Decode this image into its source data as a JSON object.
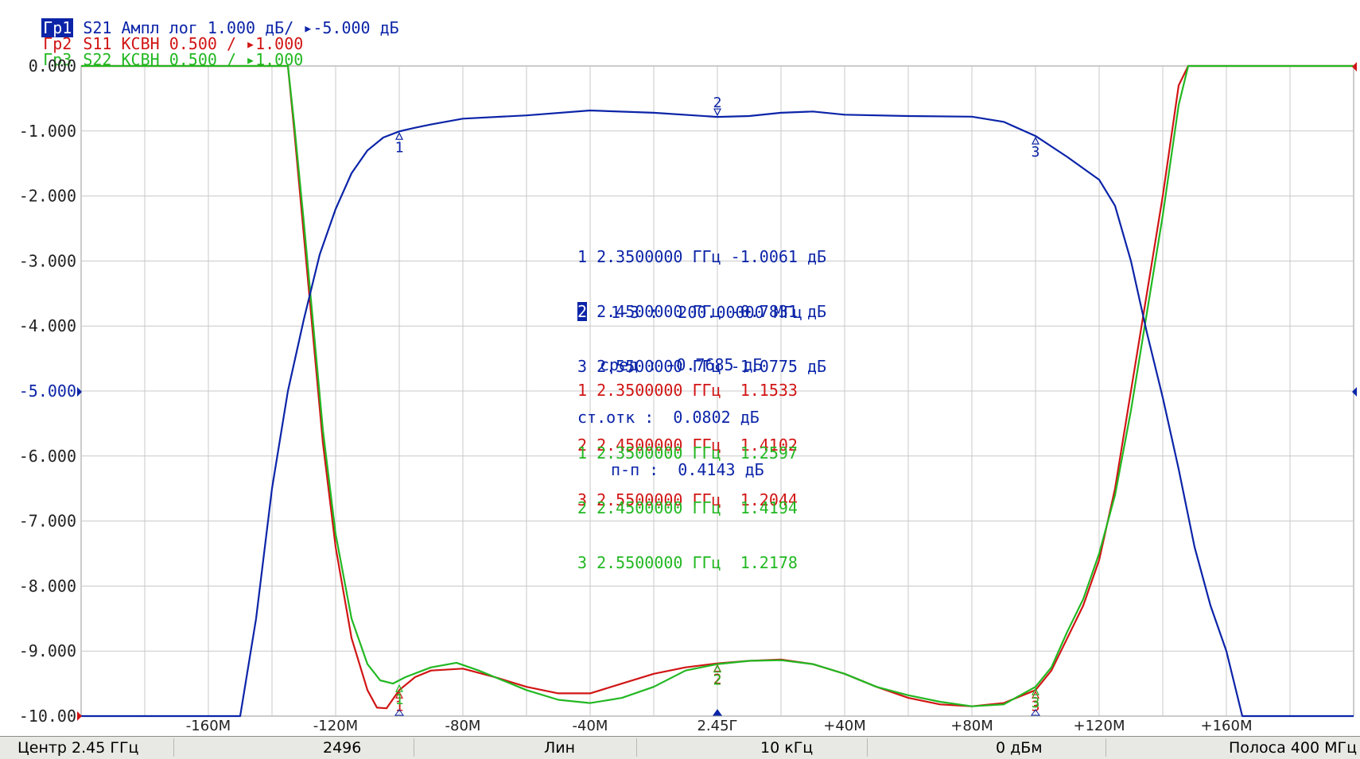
{
  "traces_header": [
    {
      "id": "tr1",
      "tag": "Гр1",
      "text": " S21 Ампл лог 1.000 дБ/ ▸-5.000 дБ",
      "color": "#0b24a8"
    },
    {
      "id": "tr2",
      "tag": "Гр2",
      "text": " S11 КСВН 0.500 / ▸1.000",
      "color": "#d11515"
    },
    {
      "id": "tr3",
      "tag": "Гр3",
      "text": " S22 КСВН 0.500 / ▸1.000",
      "color": "#22b822"
    }
  ],
  "colors": {
    "s21": "#0b24a8",
    "s11": "#d11515",
    "s22": "#22b822",
    "grid": "#c8c8c8",
    "axis_text": "#222222"
  },
  "chart_data": {
    "type": "line",
    "x_unit": "MHz offset from center 2.45 GHz",
    "xlim": [
      -200,
      200
    ],
    "ylim": [
      -10,
      0
    ],
    "grid": true,
    "y_ticks": [
      "0.000",
      "-1.000",
      "-2.000",
      "-3.000",
      "-4.000",
      "-5.000",
      "-6.000",
      "-7.000",
      "-8.000",
      "-9.000",
      "-10.00"
    ],
    "x_ticks": [
      {
        "x": -160,
        "label": "-160M"
      },
      {
        "x": -120,
        "label": "-120M"
      },
      {
        "x": -80,
        "label": "-80M"
      },
      {
        "x": -40,
        "label": "-40M"
      },
      {
        "x": 0,
        "label": "2.45Г"
      },
      {
        "x": 40,
        "label": "+40M"
      },
      {
        "x": 80,
        "label": "+80M"
      },
      {
        "x": 120,
        "label": "+120M"
      },
      {
        "x": 160,
        "label": "+160M"
      }
    ],
    "series": [
      {
        "id": "s21",
        "name": "S21",
        "points": [
          [
            -200,
            -10
          ],
          [
            -150,
            -10
          ],
          [
            -145,
            -8.5
          ],
          [
            -140,
            -6.5
          ],
          [
            -135,
            -5
          ],
          [
            -130,
            -3.9
          ],
          [
            -125,
            -2.9
          ],
          [
            -120,
            -2.2
          ],
          [
            -115,
            -1.65
          ],
          [
            -110,
            -1.3
          ],
          [
            -105,
            -1.1
          ],
          [
            -100,
            -1.0061
          ],
          [
            -95,
            -0.95
          ],
          [
            -90,
            -0.9
          ],
          [
            -80,
            -0.81
          ],
          [
            -60,
            -0.76
          ],
          [
            -40,
            -0.685
          ],
          [
            -20,
            -0.72
          ],
          [
            0,
            -0.7831
          ],
          [
            10,
            -0.77
          ],
          [
            20,
            -0.72
          ],
          [
            30,
            -0.7
          ],
          [
            40,
            -0.75
          ],
          [
            60,
            -0.77
          ],
          [
            80,
            -0.78
          ],
          [
            90,
            -0.86
          ],
          [
            100,
            -1.0775
          ],
          [
            110,
            -1.4
          ],
          [
            120,
            -1.75
          ],
          [
            125,
            -2.15
          ],
          [
            130,
            -3.0
          ],
          [
            135,
            -4.1
          ],
          [
            140,
            -5.1
          ],
          [
            145,
            -6.2
          ],
          [
            150,
            -7.4
          ],
          [
            155,
            -8.3
          ],
          [
            160,
            -9.0
          ],
          [
            165,
            -10
          ],
          [
            200,
            -10
          ]
        ],
        "markers": [
          {
            "n": "1",
            "x": -100,
            "y": -1.0061
          },
          {
            "n": "2",
            "x": 0,
            "y": -0.7831
          },
          {
            "n": "3",
            "x": 100,
            "y": -1.0775
          }
        ]
      },
      {
        "id": "s11",
        "name": "S11",
        "points": [
          [
            -200,
            0
          ],
          [
            -135,
            0
          ],
          [
            -133,
            -1.0
          ],
          [
            -130,
            -2.6
          ],
          [
            -127,
            -4.2
          ],
          [
            -124,
            -5.8
          ],
          [
            -120,
            -7.4
          ],
          [
            -115,
            -8.8
          ],
          [
            -110,
            -9.6
          ],
          [
            -107,
            -9.87
          ],
          [
            -104,
            -9.88
          ],
          [
            -100,
            -9.6
          ],
          [
            -95,
            -9.4
          ],
          [
            -90,
            -9.3
          ],
          [
            -80,
            -9.27
          ],
          [
            -70,
            -9.4
          ],
          [
            -60,
            -9.55
          ],
          [
            -50,
            -9.65
          ],
          [
            -40,
            -9.65
          ],
          [
            -30,
            -9.5
          ],
          [
            -20,
            -9.35
          ],
          [
            -10,
            -9.25
          ],
          [
            0,
            -9.19
          ],
          [
            10,
            -9.15
          ],
          [
            20,
            -9.13
          ],
          [
            30,
            -9.2
          ],
          [
            40,
            -9.35
          ],
          [
            50,
            -9.55
          ],
          [
            60,
            -9.72
          ],
          [
            70,
            -9.82
          ],
          [
            80,
            -9.85
          ],
          [
            90,
            -9.8
          ],
          [
            100,
            -9.6
          ],
          [
            105,
            -9.3
          ],
          [
            110,
            -8.8
          ],
          [
            115,
            -8.3
          ],
          [
            120,
            -7.6
          ],
          [
            125,
            -6.5
          ],
          [
            130,
            -5.0
          ],
          [
            135,
            -3.5
          ],
          [
            140,
            -2.0
          ],
          [
            145,
            -0.3
          ],
          [
            148,
            0
          ],
          [
            200,
            0
          ]
        ],
        "markers": [
          {
            "n": "1",
            "x": -100,
            "y": -9.6
          },
          {
            "n": "2",
            "x": 0,
            "y": -9.19
          },
          {
            "n": "3",
            "x": 100,
            "y": -9.6
          }
        ]
      },
      {
        "id": "s22",
        "name": "S22",
        "points": [
          [
            -200,
            0
          ],
          [
            -135,
            0
          ],
          [
            -133,
            -0.9
          ],
          [
            -130,
            -2.4
          ],
          [
            -127,
            -4.0
          ],
          [
            -124,
            -5.6
          ],
          [
            -120,
            -7.2
          ],
          [
            -115,
            -8.5
          ],
          [
            -110,
            -9.2
          ],
          [
            -106,
            -9.45
          ],
          [
            -102,
            -9.5
          ],
          [
            -98,
            -9.4
          ],
          [
            -90,
            -9.25
          ],
          [
            -82,
            -9.18
          ],
          [
            -75,
            -9.3
          ],
          [
            -60,
            -9.6
          ],
          [
            -50,
            -9.75
          ],
          [
            -40,
            -9.8
          ],
          [
            -30,
            -9.72
          ],
          [
            -20,
            -9.55
          ],
          [
            -10,
            -9.3
          ],
          [
            0,
            -9.2
          ],
          [
            10,
            -9.15
          ],
          [
            20,
            -9.14
          ],
          [
            30,
            -9.2
          ],
          [
            40,
            -9.35
          ],
          [
            50,
            -9.55
          ],
          [
            60,
            -9.68
          ],
          [
            70,
            -9.78
          ],
          [
            80,
            -9.85
          ],
          [
            90,
            -9.82
          ],
          [
            100,
            -9.55
          ],
          [
            105,
            -9.25
          ],
          [
            110,
            -8.7
          ],
          [
            115,
            -8.2
          ],
          [
            120,
            -7.5
          ],
          [
            125,
            -6.6
          ],
          [
            130,
            -5.3
          ],
          [
            135,
            -3.8
          ],
          [
            140,
            -2.3
          ],
          [
            145,
            -0.6
          ],
          [
            148,
            0
          ],
          [
            200,
            0
          ]
        ],
        "markers": [
          {
            "n": "1",
            "x": -100,
            "y": -9.5
          },
          {
            "n": "2",
            "x": 0,
            "y": -9.2
          },
          {
            "n": "3",
            "x": 100,
            "y": -9.55
          }
        ]
      }
    ]
  },
  "marker_table": {
    "s21": [
      "1 2.3500000 ГГц -1.0061 дБ",
      "2.4500000 ГГц -0.7831 дБ",
      "3 2.5500000 ГГц -1.0775 дБ"
    ],
    "s21_active_num": "2",
    "stats": [
      "1-3 :  200.00000 МГц",
      "сред : -0.7685 дБ",
      "ст.отк :  0.0802 дБ",
      "п-п :  0.4143 дБ"
    ],
    "s11": [
      "1 2.3500000 ГГц  1.1533",
      "2 2.4500000 ГГц  1.4102",
      "3 2.5500000 ГГц  1.2044"
    ],
    "s22": [
      "1 2.3500000 ГГц  1.2597",
      "2 2.4500000 ГГц  1.4194",
      "3 2.5500000 ГГц  1.2178"
    ]
  },
  "status_bar": {
    "center": "Центр 2.45 ГГц",
    "points": "2496",
    "sweep_type": "Лин",
    "ifbw": "10 кГц",
    "power": "0 дБм",
    "span": "Полоса 400 МГц"
  }
}
